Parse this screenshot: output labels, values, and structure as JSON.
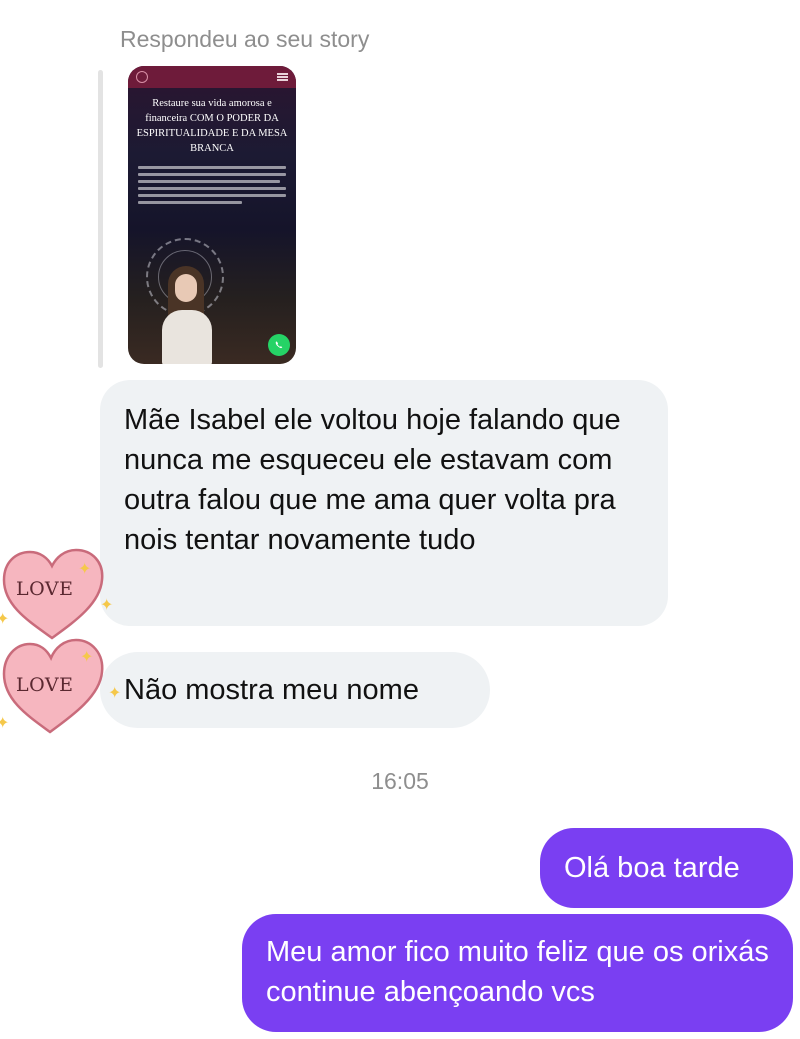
{
  "thread": {
    "reply_label": "Respondeu ao seu story",
    "story": {
      "headline": "Restaure sua vida amorosa e financeira COM O PODER DA ESPIRITUALIDADE E DA MESA BRANCA",
      "logo_icon": "mandala-logo-icon",
      "menu_icon": "hamburger-menu-icon",
      "whatsapp_icon": "whatsapp-icon"
    },
    "messages_in": [
      {
        "text": "Mãe Isabel ele voltou hoje falando que nunca me esqueceu ele estavam com outra falou que me ama quer volta pra nois tentar novamente tudo"
      },
      {
        "text": "Não mostra meu nome"
      }
    ],
    "time_label": "16:05",
    "messages_out": [
      {
        "text": "Olá boa tarde"
      },
      {
        "text": "Meu amor fico muito feliz que os orixás continue abençoando vcs"
      }
    ],
    "stickers": [
      {
        "text": "LOVE"
      },
      {
        "text": "LOVE"
      }
    ]
  },
  "colors": {
    "outgoing_bubble": "#7a3ff2",
    "incoming_bubble": "#eff2f4",
    "sticker_heart": "#f6b6bf",
    "meta_text": "#8e8e8e"
  }
}
